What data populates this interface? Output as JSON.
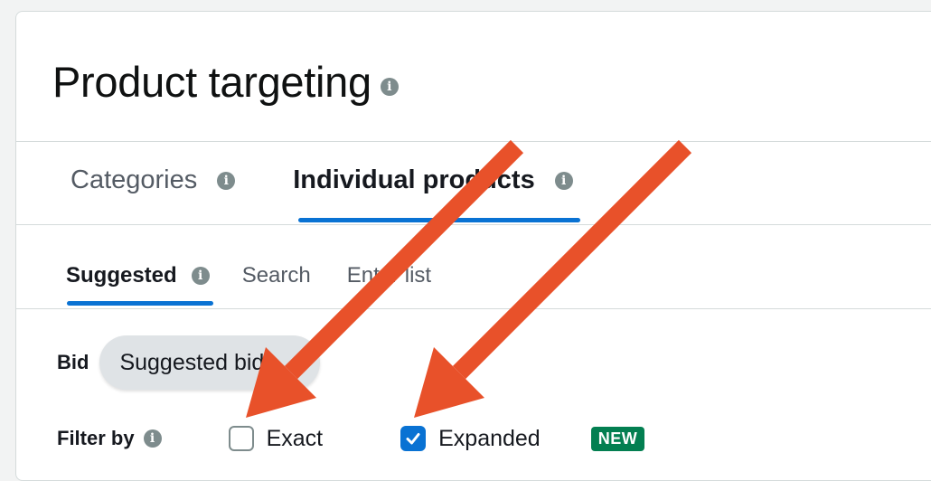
{
  "header": {
    "title": "Product targeting"
  },
  "main_tabs": [
    {
      "label": "Categories",
      "active": false
    },
    {
      "label": "Individual products",
      "active": true
    }
  ],
  "sub_tabs": [
    {
      "label": "Suggested",
      "active": true
    },
    {
      "label": "Search",
      "active": false
    },
    {
      "label": "Enter list",
      "active": false
    }
  ],
  "bid": {
    "label": "Bid",
    "selected": "Suggested bid"
  },
  "filter": {
    "label": "Filter by",
    "options": [
      {
        "label": "Exact",
        "checked": false
      },
      {
        "label": "Expanded",
        "checked": true
      }
    ],
    "badge": "NEW"
  },
  "colors": {
    "accent": "#0972d3",
    "badge": "#037f51",
    "annotation_arrow": "#e8512a"
  },
  "icons": [
    "info-icon",
    "checkmark-icon",
    "arrow-annotation"
  ]
}
